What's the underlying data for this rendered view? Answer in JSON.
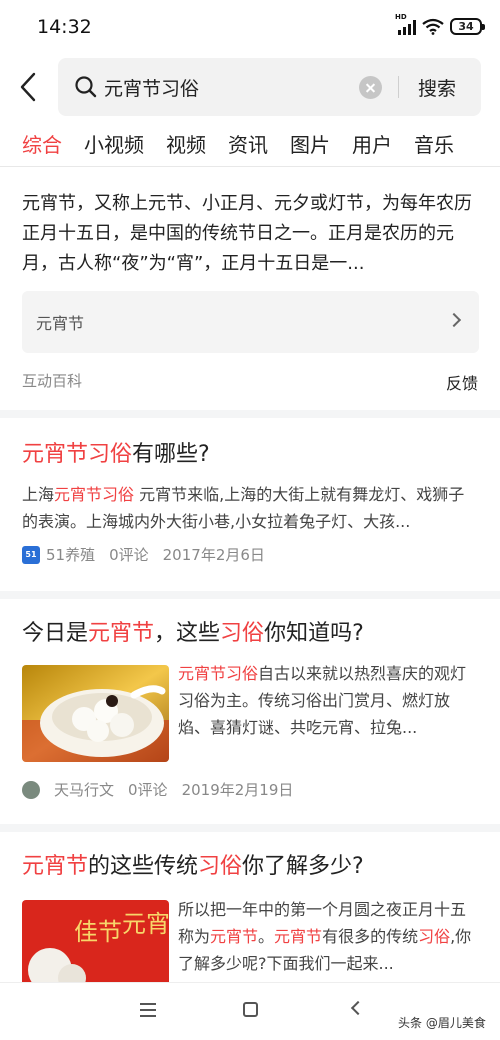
{
  "status_bar": {
    "time": "14:32",
    "network_label": "HD",
    "battery": "34"
  },
  "search": {
    "query": "元宵节习俗",
    "submit_label": "搜索"
  },
  "tabs": [
    {
      "label": "综合",
      "active": true
    },
    {
      "label": "小视频",
      "active": false
    },
    {
      "label": "视频",
      "active": false
    },
    {
      "label": "资讯",
      "active": false
    },
    {
      "label": "图片",
      "active": false
    },
    {
      "label": "用户",
      "active": false
    },
    {
      "label": "音乐",
      "active": false
    }
  ],
  "baike": {
    "text": "元宵节，又称上元节、小正月、元夕或灯节，为每年农历正月十五日，是中国的传统节日之一。正月是农历的元月，古人称“夜”为“宵”，正月十五日是一...",
    "link_label": "元宵节",
    "source": "互动百科",
    "feedback_label": "反馈"
  },
  "articles": [
    {
      "title_parts": [
        "元宵节习俗",
        "有哪些?"
      ],
      "snippet_parts": [
        "上海",
        "元宵节习俗",
        " 元宵节来临,上海的大街上就有舞龙灯、戏狮子的表演。上海城内外大街小巷,小女拉着兔子灯、大孩..."
      ],
      "source": "51养殖",
      "source_icon_text": "51",
      "comments": "0评论",
      "date": "2017年2月6日"
    },
    {
      "title_parts": [
        "今日是",
        "元宵节",
        "，这些",
        "习俗",
        "你知道吗?"
      ],
      "snippet_parts": [
        "元宵节习俗",
        "自古以来就以热烈喜庆的观灯习俗为主。传统习俗出门赏月、燃灯放焰、喜猜灯谜、共吃元宵、拉兔..."
      ],
      "source": "天马行文",
      "comments": "0评论",
      "date": "2019年2月19日"
    },
    {
      "title_parts": [
        "元宵节",
        "的这些传统",
        "习俗",
        "你了解多少?"
      ],
      "snippet_parts": [
        "所以把一年中的第一个月圆之夜正月十五称为",
        "元宵节",
        "。",
        "元宵节",
        "有很多的传统",
        "习俗",
        ",你了解多少呢?下面我们一起来..."
      ],
      "thumb_text": [
        "元宵",
        "佳节"
      ]
    }
  ],
  "watermark": "头条 @眉儿美食",
  "colors": {
    "accent": "#f04142",
    "separator": "#f4f5f6",
    "search_bg": "#f2f2f2"
  }
}
